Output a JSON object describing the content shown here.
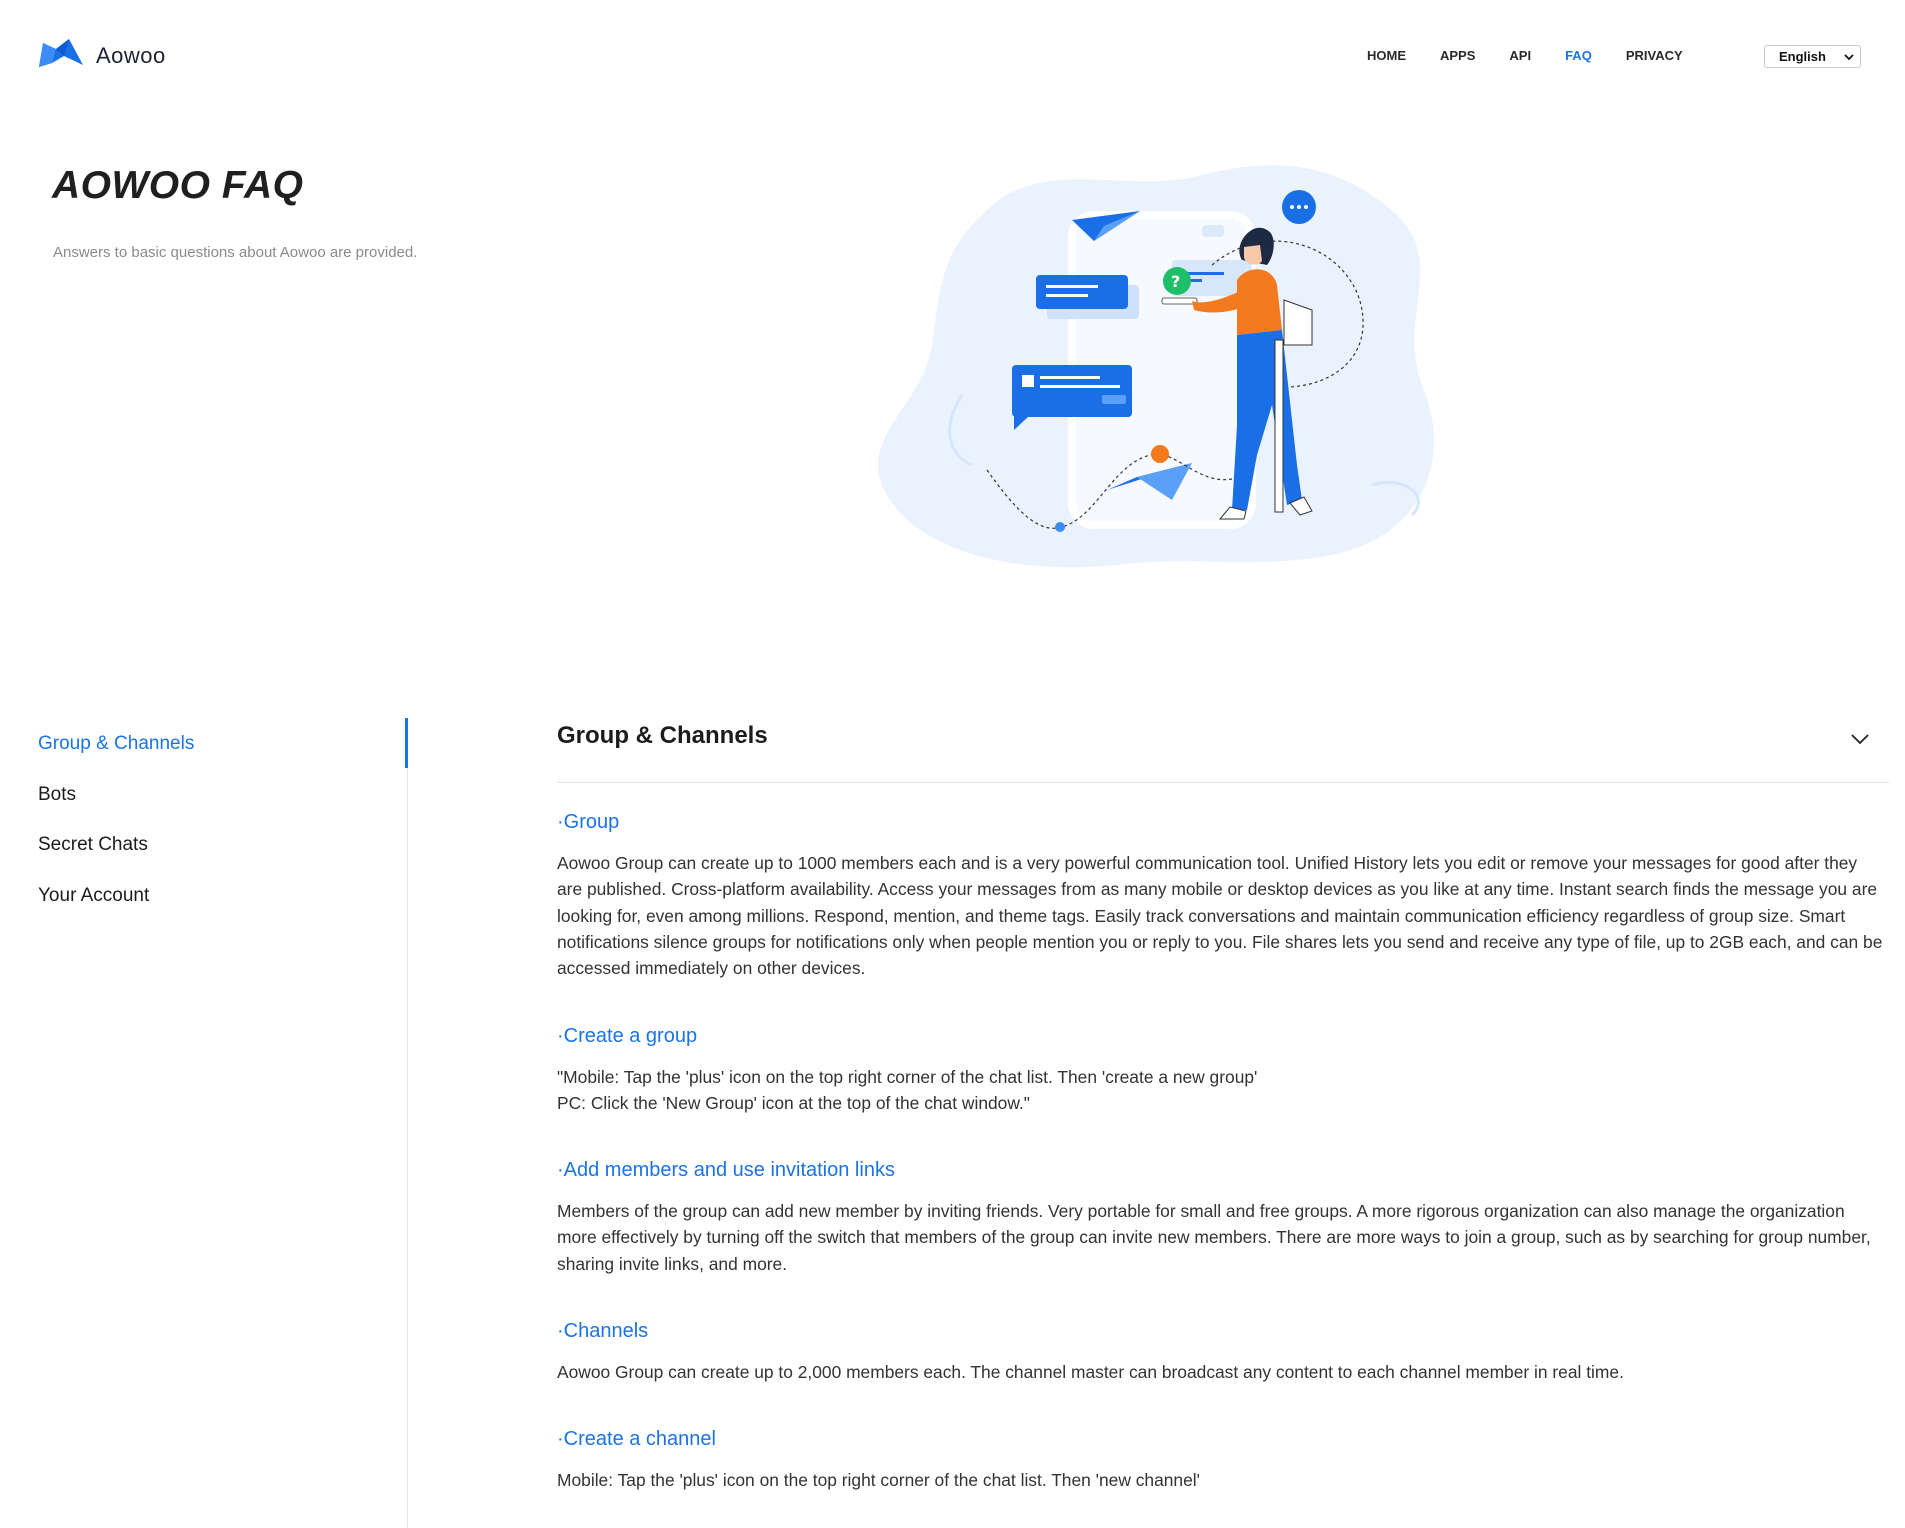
{
  "header": {
    "brand": "Aowoo",
    "logo_icon": "aowoo-logo-icon",
    "nav": [
      {
        "label": "HOME",
        "active": false
      },
      {
        "label": "APPS",
        "active": false
      },
      {
        "label": "API",
        "active": false
      },
      {
        "label": "FAQ",
        "active": true
      },
      {
        "label": "PRIVACY",
        "active": false
      }
    ],
    "language": "English"
  },
  "hero": {
    "title": "AOWOO FAQ",
    "subtitle": "Answers to basic questions about Aowoo are provided.",
    "illustration_icon": "person-chat-illustration"
  },
  "sidebar": {
    "items": [
      {
        "label": "Group & Channels",
        "active": true
      },
      {
        "label": "Bots",
        "active": false
      },
      {
        "label": "Secret Chats",
        "active": false
      },
      {
        "label": "Your Account",
        "active": false
      }
    ]
  },
  "section": {
    "title": "Group & Channels",
    "toggle_icon": "chevron-down-icon",
    "faqs": [
      {
        "q": "·Group",
        "a": "Aowoo Group can create up to 1000 members each and is a very powerful communication tool. Unified History lets you edit or remove your messages for good after they are published. Cross-platform availability. Access your messages from as many mobile or desktop devices as you like at any time. Instant search finds the message you are looking for, even among millions. Respond, mention, and theme tags. Easily track conversations and maintain communication efficiency regardless of group size. Smart notifications silence groups for notifications only when people mention you or reply to you. File shares lets you send and receive any type of file, up to 2GB each, and can be accessed immediately on other devices."
      },
      {
        "q": "·Create a group",
        "a": "\"Mobile: Tap the 'plus' icon on the top right corner of the chat list. Then 'create a new group'\nPC: Click the 'New Group' icon at the top of the chat window.\""
      },
      {
        "q": "·Add members and use invitation links",
        "a": "Members of the group can add new member by inviting friends. Very portable for small and free groups. A more rigorous organization can also manage the organization more effectively by turning off the switch that members of the group can invite new members. There are more ways to join a group, such as by searching for group number, sharing invite links, and more."
      },
      {
        "q": "·Channels",
        "a": "Aowoo Group can create up to 2,000 members each. The channel master can broadcast any content to each channel member in real time."
      },
      {
        "q": "·Create a channel",
        "a": "Mobile: Tap the 'plus' icon on the top right corner of the chat list. Then 'new channel'"
      }
    ]
  },
  "colors": {
    "accent": "#1a73e8",
    "illustration_bg": "#eaf3fd",
    "figure_orange": "#f47a20",
    "figure_blue": "#1b6fe6",
    "help_green": "#1fbf6a"
  }
}
